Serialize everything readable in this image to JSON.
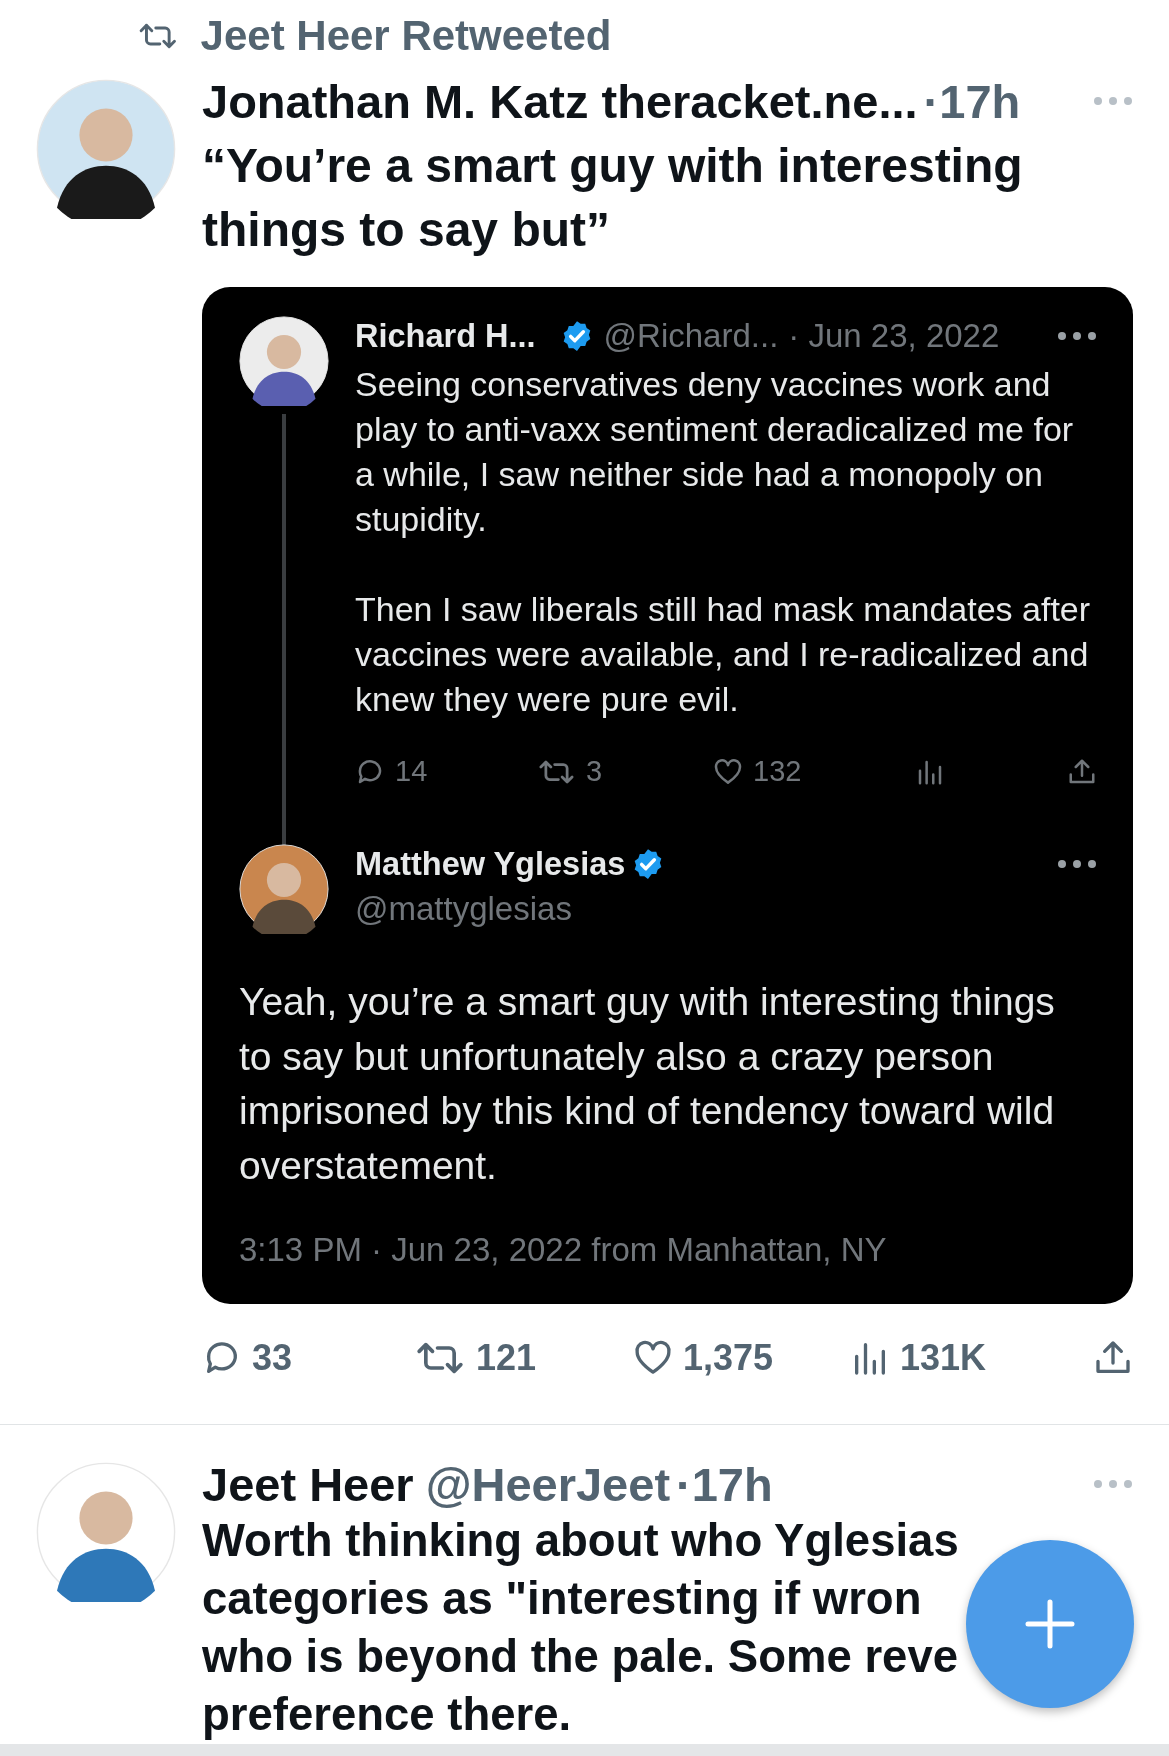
{
  "retweet_banner": {
    "text": "Jeet Heer Retweeted"
  },
  "tweets": [
    {
      "kind": "quote",
      "author": "Jonathan M. Katz theracket.ne...",
      "time": "·17h",
      "text": "“You’re a smart guy with interesting things to say but”",
      "embed": {
        "tweets": [
          {
            "kind": "reply_parent",
            "name": "Richard H...",
            "verified": true,
            "handle": "@Richard...",
            "time": "· Jun 23, 2022",
            "paragraphs": [
              "Seeing conservatives deny vaccines work and play to anti-vaxx sentiment deradicalized me for a while, I saw neither side had a monopoly on stupidity.",
              "Then I saw liberals still had mask mandates after vaccines were available, and I re-radicalized and knew they were pure evil."
            ],
            "actions": [
              {
                "kind": "reply",
                "count": "14"
              },
              {
                "kind": "retweet",
                "count": "3"
              },
              {
                "kind": "like",
                "count": "132"
              },
              {
                "kind": "views"
              },
              {
                "kind": "share"
              }
            ]
          },
          {
            "kind": "focus",
            "name": "Matthew Yglesias",
            "verified": true,
            "handle": "@mattyglesias",
            "paragraphs": [
              "Yeah, you’re a smart guy with interesting things to say but unfortunately also a crazy person imprisoned by this kind of tendency toward wild overstatement."
            ],
            "timestamp": "3:13 PM · Jun 23, 2022 from Manhattan, NY"
          }
        ]
      },
      "actions": [
        {
          "kind": "reply",
          "count": "33"
        },
        {
          "kind": "retweet",
          "count": "121"
        },
        {
          "kind": "like",
          "count": "1,375"
        },
        {
          "kind": "views",
          "count": "131K"
        },
        {
          "kind": "share"
        }
      ]
    },
    {
      "kind": "plain",
      "author": "Jeet Heer",
      "handle": "@HeerJeet",
      "time": "·17h",
      "lines": [
        "Worth thinking about who Yglesias",
        "categories as \"interesting if wron",
        "who is beyond the pale. Some reve",
        "preference there."
      ]
    }
  ],
  "compose_button": {
    "kind": "plus"
  }
}
